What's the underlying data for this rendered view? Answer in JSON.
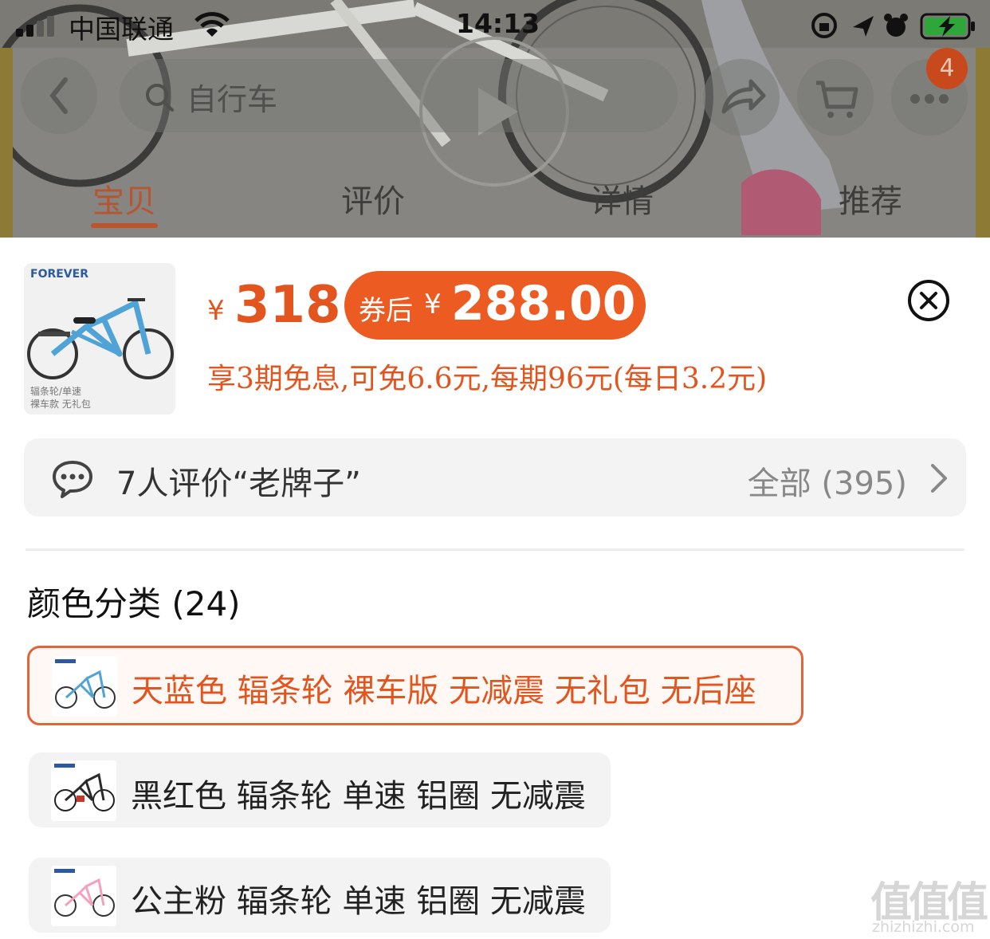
{
  "status_bar": {
    "carrier": "中国联通",
    "time": "14:13"
  },
  "nav": {
    "search_placeholder": "自行车",
    "cart_badge": "4"
  },
  "tabs": [
    {
      "label": "宝贝",
      "active": true
    },
    {
      "label": "评价",
      "active": false
    },
    {
      "label": "详情",
      "active": false
    },
    {
      "label": "推荐",
      "active": false
    }
  ],
  "product": {
    "thumb_brand": "FOREVER",
    "thumb_caption_1": "辐条轮/单速",
    "thumb_caption_2": "裸车款 无礼包",
    "currency": "¥",
    "price": "318",
    "coupon_label": "券后",
    "coupon_currency": "¥",
    "coupon_price": "288.00",
    "installment": "享3期免息,可免6.6元,每期96元(每日3.2元)"
  },
  "reviews": {
    "summary": "7人评价“老牌子”",
    "all_label": "全部 (395)"
  },
  "variants": {
    "title": "颜色分类 (24)",
    "options": [
      {
        "label": "天蓝色 辐条轮 裸车版 无减震  无礼包  无后座",
        "selected": true,
        "bike_color": "#4fa3d6"
      },
      {
        "label": "黑红色 辐条轮 单速 铝圈 无减震",
        "selected": false,
        "bike_color": "#2a2a2a"
      },
      {
        "label": "公主粉 辐条轮 单速 铝圈 无减震",
        "selected": false,
        "bike_color": "#f2a2bf"
      }
    ]
  },
  "colors": {
    "accent": "#e2551e",
    "coupon_bg": "#ec5b21",
    "selected_border": "#e2643a"
  },
  "watermark": {
    "glyphs": "值值值",
    "site": "zhizhizhi.com"
  }
}
